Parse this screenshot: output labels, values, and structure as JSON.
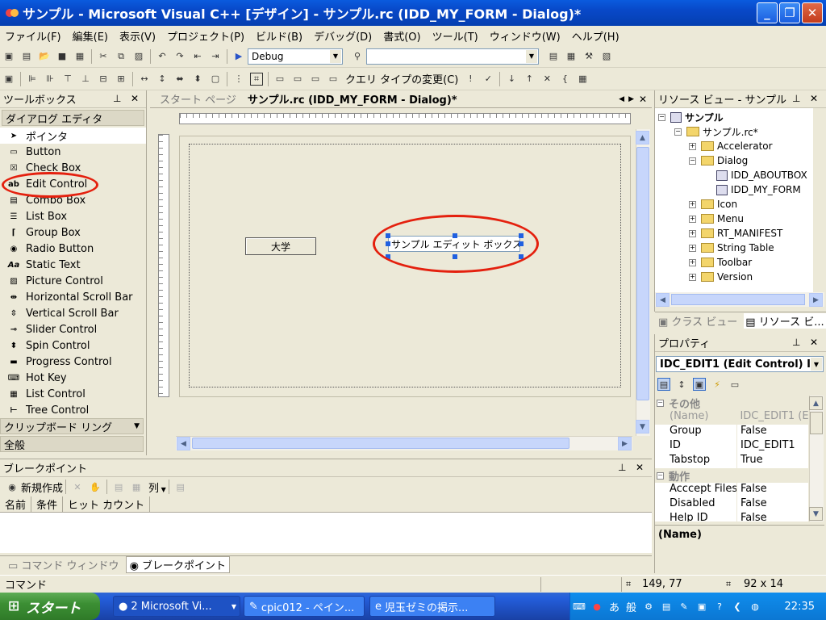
{
  "window": {
    "title": "サンプル - Microsoft Visual C++ [デザイン] - サンプル.rc (IDD_MY_FORM - Dialog)*"
  },
  "menu": [
    "ファイル(F)",
    "編集(E)",
    "表示(V)",
    "プロジェクト(P)",
    "ビルド(B)",
    "デバッグ(D)",
    "書式(O)",
    "ツール(T)",
    "ウィンドウ(W)",
    "ヘルプ(H)"
  ],
  "toolbar1": {
    "config": "Debug",
    "combo2": ""
  },
  "toolbar2": {
    "query_type": "クエリ タイプの変更(C)"
  },
  "toolbox": {
    "title": "ツールボックス",
    "group": "ダイアログ エディタ",
    "items": [
      "ポインタ",
      "Button",
      "Check Box",
      "Edit Control",
      "Combo Box",
      "List Box",
      "Group Box",
      "Radio Button",
      "Static Text",
      "Picture Control",
      "Horizontal Scroll Bar",
      "Vertical Scroll Bar",
      "Slider Control",
      "Spin Control",
      "Progress Control",
      "Hot Key",
      "List Control",
      "Tree Control"
    ],
    "clipboard_group": "クリップボード リング",
    "general_group": "全般"
  },
  "editor": {
    "tab_start": "スタート ページ",
    "tab_active": "サンプル.rc (IDD_MY_FORM - Dialog)*",
    "button_label": "大学",
    "edit_text": "サンプル エディット ボックス"
  },
  "resource_view": {
    "title": "リソース ビュー - サンプル",
    "root": "サンプル",
    "rc": "サンプル.rc*",
    "nodes": [
      "Accelerator",
      "Dialog",
      "IDD_ABOUTBOX",
      "IDD_MY_FORM",
      "Icon",
      "Menu",
      "RT_MANIFEST",
      "String Table",
      "Toolbar",
      "Version"
    ],
    "tab_class": "クラス ビュー",
    "tab_resource": "リソース ビ..."
  },
  "properties": {
    "title": "プロパティ",
    "selector": "IDC_EDIT1 (Edit Control) I",
    "cat_other": "その他",
    "cat_behavior": "動作",
    "rows": [
      {
        "name": "(Name)",
        "value": "IDC_EDIT1 (E"
      },
      {
        "name": "Group",
        "value": "False"
      },
      {
        "name": "ID",
        "value": "IDC_EDIT1"
      },
      {
        "name": "Tabstop",
        "value": "True"
      },
      {
        "name": "Acccept Files",
        "value": "False"
      },
      {
        "name": "Disabled",
        "value": "False"
      },
      {
        "name": "Help ID",
        "value": "False"
      }
    ],
    "description": "(Name)"
  },
  "breakpoints": {
    "title": "ブレークポイント",
    "new_btn": "新規作成",
    "columns_btn": "列",
    "columns": [
      "名前",
      "条件",
      "ヒット カウント"
    ],
    "tab_command": "コマンド ウィンドウ",
    "tab_breakpoints": "ブレークポイント"
  },
  "status": {
    "text": "コマンド",
    "position": "149, 77",
    "size": "92 x 14"
  },
  "taskbar": {
    "start": "スタート",
    "tasks": [
      "2 Microsoft Vi...",
      "cpic012 - ペイン...",
      "児玉ゼミの掲示..."
    ],
    "ime1": "あ",
    "ime2": "般",
    "clock": "22:35"
  },
  "colors": {
    "highlight": "#e4200e",
    "titlebar": "#0a5bde",
    "taskbar": "#245edb"
  }
}
